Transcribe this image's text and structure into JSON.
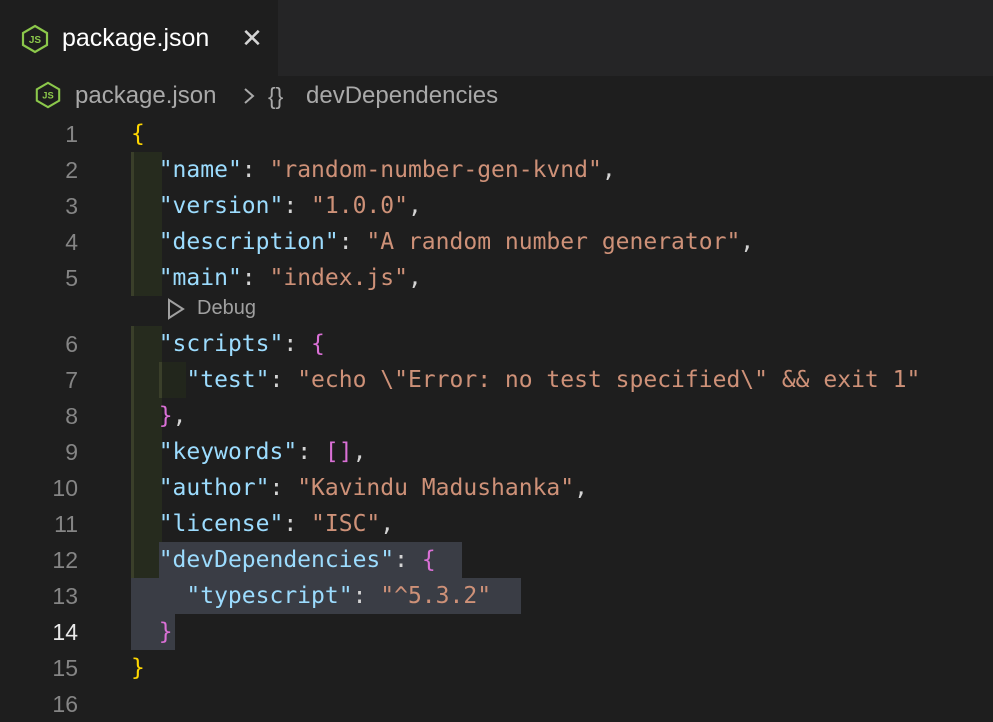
{
  "tab": {
    "label": "package.json",
    "close_glyph": "✕",
    "icon": "json-js-file-icon"
  },
  "breadcrumb": {
    "file": "package.json",
    "braces": "{}",
    "symbol": "devDependencies"
  },
  "codelens": {
    "label": "Debug"
  },
  "editor": {
    "active_line": 14,
    "line_numbers": [
      "1",
      "2",
      "3",
      "4",
      "5",
      "6",
      "7",
      "8",
      "9",
      "10",
      "11",
      "12",
      "13",
      "14",
      "15",
      "16"
    ],
    "lines": [
      [
        {
          "t": "{",
          "c": "brace-y"
        }
      ],
      [
        {
          "t": "  "
        },
        {
          "t": "\"name\"",
          "c": "key"
        },
        {
          "t": ": ",
          "c": "punct"
        },
        {
          "t": "\"random-number-gen-kvnd\"",
          "c": "str"
        },
        {
          "t": ",",
          "c": "punct"
        }
      ],
      [
        {
          "t": "  "
        },
        {
          "t": "\"version\"",
          "c": "key"
        },
        {
          "t": ": ",
          "c": "punct"
        },
        {
          "t": "\"1.0.0\"",
          "c": "str"
        },
        {
          "t": ",",
          "c": "punct"
        }
      ],
      [
        {
          "t": "  "
        },
        {
          "t": "\"description\"",
          "c": "key"
        },
        {
          "t": ": ",
          "c": "punct"
        },
        {
          "t": "\"A random number generator\"",
          "c": "str"
        },
        {
          "t": ",",
          "c": "punct"
        }
      ],
      [
        {
          "t": "  "
        },
        {
          "t": "\"main\"",
          "c": "key"
        },
        {
          "t": ": ",
          "c": "punct"
        },
        {
          "t": "\"index.js\"",
          "c": "str"
        },
        {
          "t": ",",
          "c": "punct"
        }
      ],
      [
        {
          "t": "  "
        },
        {
          "t": "\"scripts\"",
          "c": "key"
        },
        {
          "t": ": ",
          "c": "punct"
        },
        {
          "t": "{",
          "c": "brace-p"
        }
      ],
      [
        {
          "t": "    "
        },
        {
          "t": "\"test\"",
          "c": "key"
        },
        {
          "t": ": ",
          "c": "punct"
        },
        {
          "t": "\"echo \\\"Error: no test specified\\\" && exit 1\"",
          "c": "str"
        }
      ],
      [
        {
          "t": "  "
        },
        {
          "t": "}",
          "c": "brace-p"
        },
        {
          "t": ",",
          "c": "punct"
        }
      ],
      [
        {
          "t": "  "
        },
        {
          "t": "\"keywords\"",
          "c": "key"
        },
        {
          "t": ": ",
          "c": "punct"
        },
        {
          "t": "[]",
          "c": "brace-p"
        },
        {
          "t": ",",
          "c": "punct"
        }
      ],
      [
        {
          "t": "  "
        },
        {
          "t": "\"author\"",
          "c": "key"
        },
        {
          "t": ": ",
          "c": "punct"
        },
        {
          "t": "\"Kavindu Madushanka\"",
          "c": "str"
        },
        {
          "t": ",",
          "c": "punct"
        }
      ],
      [
        {
          "t": "  "
        },
        {
          "t": "\"license\"",
          "c": "key"
        },
        {
          "t": ": ",
          "c": "punct"
        },
        {
          "t": "\"ISC\"",
          "c": "str"
        },
        {
          "t": ",",
          "c": "punct"
        }
      ],
      [
        {
          "t": "  "
        },
        {
          "t": "\"devDependencies\"",
          "c": "key"
        },
        {
          "t": ": ",
          "c": "punct"
        },
        {
          "t": "{",
          "c": "brace-p"
        }
      ],
      [
        {
          "t": "    "
        },
        {
          "t": "\"typescript\"",
          "c": "key"
        },
        {
          "t": ": ",
          "c": "punct"
        },
        {
          "t": "\"^5.3.2\"",
          "c": "str"
        }
      ],
      [
        {
          "t": "  "
        },
        {
          "t": "}",
          "c": "brace-p"
        }
      ],
      [
        {
          "t": "}",
          "c": "brace-y"
        }
      ],
      []
    ]
  },
  "colors": {
    "background": "#1e1e1e",
    "key": "#9cdcfe",
    "string": "#ce9178",
    "brace_level1": "#ffd700",
    "brace_level2": "#da70d6",
    "selection": "#3a3d45"
  }
}
